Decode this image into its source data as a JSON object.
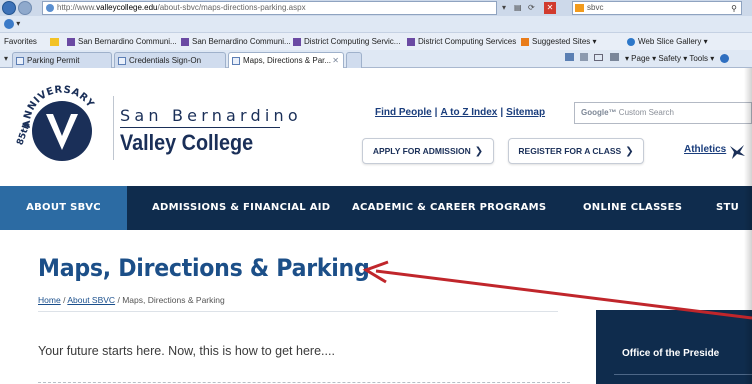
{
  "browser": {
    "url_prefix": "http://www.",
    "url_domain": "valleycollege.edu",
    "url_path": "/about-sbvc/maps-directions-parking.aspx",
    "search_text": "sbvc",
    "command_label": "Favorites",
    "favorites": [
      {
        "label": "San Bernardino Communi...",
        "icon": "college-icon"
      },
      {
        "label": "San Bernardino Communi...",
        "icon": "college-icon"
      },
      {
        "label": "District Computing Servic...",
        "icon": "college-icon"
      },
      {
        "label": "District Computing Services",
        "icon": "college-icon"
      },
      {
        "label": "Suggested Sites ▾",
        "icon": "suggested-sites-icon"
      },
      {
        "label": "Web Slice Gallery ▾",
        "icon": "web-slice-icon"
      }
    ],
    "tabs": [
      {
        "label": "Parking Permit"
      },
      {
        "label": "Credentials Sign-On"
      },
      {
        "label": "Maps, Directions & Par..."
      }
    ],
    "toolbar_right": "▾  Page ▾   Safety ▾   Tools ▾"
  },
  "header": {
    "logo_arc": "ANNIVERSARY",
    "logo_number": "85th",
    "name_line1": "San Bernardino",
    "name_line2": "Valley College",
    "util_links": [
      "Find People",
      "A to Z Index",
      "Sitemap"
    ],
    "search_placeholder": "Custom Search",
    "search_brand": "Google™",
    "cta_admission": "APPLY FOR ADMISSION",
    "cta_register": "REGISTER FOR A CLASS",
    "athletics_label": "Athletics"
  },
  "nav": {
    "items": [
      {
        "label": "ABOUT SBVC"
      },
      {
        "label": "ADMISSIONS & FINANCIAL AID"
      },
      {
        "label": "ACADEMIC & CAREER PROGRAMS"
      },
      {
        "label": "ONLINE CLASSES"
      },
      {
        "label": "STU"
      }
    ]
  },
  "content": {
    "title": "Maps, Directions & Parking",
    "breadcrumb": [
      {
        "label": "Home",
        "link": true
      },
      {
        "label": "About SBVC",
        "link": true
      },
      {
        "label": "Maps, Directions & Parking",
        "link": false
      }
    ],
    "intro": "Your future starts here. Now, this is how to get here....",
    "sidebar_title": "Office of the Preside"
  },
  "colors": {
    "brand_navy": "#0f2c4d",
    "nav_active": "#2c6ba3",
    "title_blue": "#1c4f88",
    "arrow_red": "#c0262b"
  }
}
